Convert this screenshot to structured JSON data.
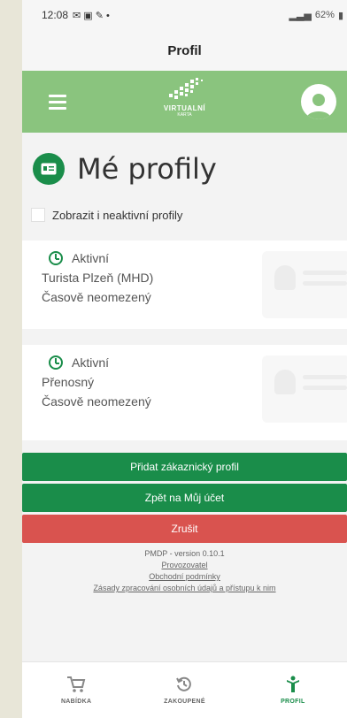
{
  "status_bar": {
    "time": "12:08",
    "right_text": "62%"
  },
  "title": "Profil",
  "logo": {
    "line1": "VIRTUALNÍ",
    "line2": "KARTA"
  },
  "heading": "Mé profily",
  "show_inactive_label": "Zobrazit i neaktivní profily",
  "profiles": [
    {
      "status": "Aktivní",
      "name": "Turista Plzeň (MHD)",
      "validity": "Časově neomezený"
    },
    {
      "status": "Aktivní",
      "name": "Přenosný",
      "validity": "Časově neomezený"
    }
  ],
  "buttons": {
    "add_profile": "Přidat zákaznický profil",
    "back_to_account": "Zpět na Můj účet",
    "cancel": "Zrušit"
  },
  "footer": {
    "version": "PMDP - version 0.10.1",
    "operator": "Provozovatel",
    "terms": "Obchodní podmínky",
    "privacy": "Zásady zpracování osobních údajů a přístupu k nim"
  },
  "nav": [
    {
      "label": "NABÍDKA",
      "icon": "cart-icon"
    },
    {
      "label": "ZAKOUPENÉ",
      "icon": "history-icon"
    },
    {
      "label": "PROFIL",
      "icon": "person-icon"
    }
  ],
  "colors": {
    "primary_green": "#1a8d4a",
    "header_green": "#8ac47e",
    "cancel_red": "#d9534f"
  }
}
